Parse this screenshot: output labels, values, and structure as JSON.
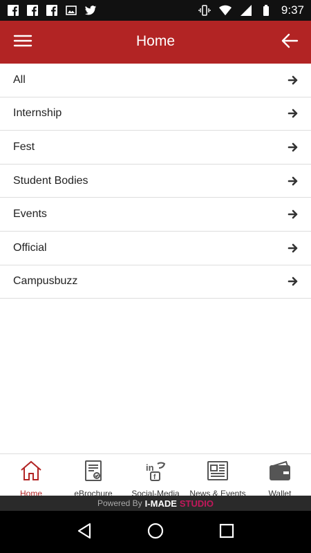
{
  "status_bar": {
    "time": "9:37",
    "left_icons": [
      "facebook-icon",
      "facebook-icon",
      "facebook-icon",
      "image-icon",
      "twitter-icon"
    ],
    "right_icons": [
      "vibrate-icon",
      "wifi-icon",
      "signal-icon",
      "battery-icon"
    ]
  },
  "app_bar": {
    "title": "Home",
    "background": "#b22424"
  },
  "list": {
    "items": [
      {
        "label": "All"
      },
      {
        "label": "Internship"
      },
      {
        "label": "Fest"
      },
      {
        "label": "Student Bodies"
      },
      {
        "label": "Events"
      },
      {
        "label": "Official"
      },
      {
        "label": "Campusbuzz"
      }
    ]
  },
  "bottom_nav": {
    "items": [
      {
        "label": "Home",
        "icon": "home-icon",
        "active": true
      },
      {
        "label": "eBrochure",
        "icon": "brochure-icon",
        "active": false
      },
      {
        "label": "Social-Media",
        "icon": "social-media-icon",
        "active": false
      },
      {
        "label": "News & Events",
        "icon": "newspaper-icon",
        "active": false
      },
      {
        "label": "Wallet",
        "icon": "wallet-icon",
        "active": false
      }
    ],
    "active_color": "#b22424"
  },
  "footer": {
    "powered_by": "Powered By",
    "brand_part1": "I-MADE",
    "brand_part2": "STUDIO"
  }
}
